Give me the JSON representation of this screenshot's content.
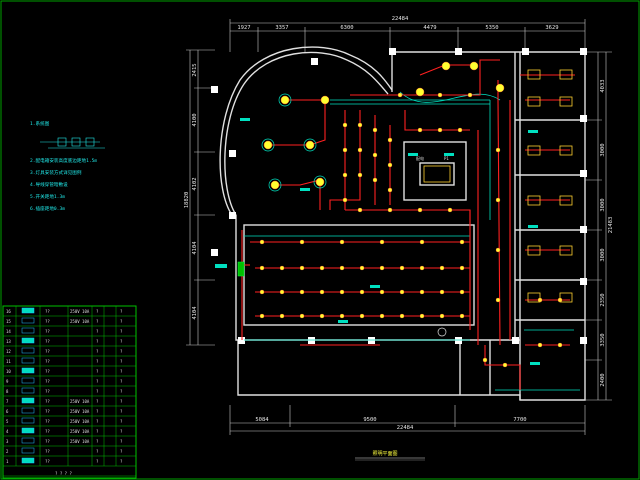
{
  "drawing": {
    "colors": {
      "background": "#000000",
      "wall": "#e8e8e8",
      "dimension": "#d0d0d0",
      "wiring": "#ff2020",
      "fixture": "#ffff30",
      "annotation": "#20e8e8",
      "green_frame": "#00b000",
      "cyan_device": "#00e0c0"
    },
    "top_dimensions": [
      "1927",
      "3357",
      "6300",
      "4479",
      "5350",
      "3629"
    ],
    "top_total": "22484",
    "bottom_dimensions": [
      "5084",
      "9500",
      "7700"
    ],
    "bottom_total": "22484",
    "left_dimensions": [
      "2415",
      "4100",
      "4102",
      "4104",
      "4104"
    ],
    "left_total": "18820",
    "right_dimensions": [
      "4033",
      "3000",
      "3000",
      "3000",
      "2350",
      "3350",
      "2400"
    ],
    "right_total": "21483",
    "title": "照明平面图",
    "notes": [
      "1.系统图",
      "2.配电箱安装高度底边距地1.5m",
      "3.灯具安装方式详见图例",
      "4.导线穿管暗敷设",
      "5.开关距地1.3m",
      "6.插座距地0.3m"
    ],
    "room_labels": [
      "配电",
      "P1"
    ]
  },
  "legend": {
    "rows": [
      {
        "num": "16",
        "text": "??",
        "spec": "250V 10A",
        "qty": "?",
        "note": "?"
      },
      {
        "num": "15",
        "text": "??",
        "spec": "250V 10A",
        "qty": "?",
        "note": "?"
      },
      {
        "num": "14",
        "text": "??",
        "spec": "",
        "qty": "?",
        "note": "?"
      },
      {
        "num": "13",
        "text": "??",
        "spec": "",
        "qty": "?",
        "note": "?"
      },
      {
        "num": "12",
        "text": "??",
        "spec": "",
        "qty": "?",
        "note": "?"
      },
      {
        "num": "11",
        "text": "??",
        "spec": "",
        "qty": "?",
        "note": "?"
      },
      {
        "num": "10",
        "text": "??",
        "spec": "",
        "qty": "?",
        "note": "?"
      },
      {
        "num": "9",
        "text": "??",
        "spec": "",
        "qty": "?",
        "note": "?"
      },
      {
        "num": "8",
        "text": "??",
        "spec": "",
        "qty": "?",
        "note": "?"
      },
      {
        "num": "7",
        "text": "??",
        "spec": "250V 10A",
        "qty": "?",
        "note": "?"
      },
      {
        "num": "6",
        "text": "??",
        "spec": "250V 10A",
        "qty": "?",
        "note": "?"
      },
      {
        "num": "5",
        "text": "??",
        "spec": "250V 10A",
        "qty": "?",
        "note": "?"
      },
      {
        "num": "4",
        "text": "??",
        "spec": "250V 10A",
        "qty": "?",
        "note": "?"
      },
      {
        "num": "3",
        "text": "??",
        "spec": "250V 10A",
        "qty": "?",
        "note": "?"
      },
      {
        "num": "2",
        "text": "??",
        "spec": "",
        "qty": "?",
        "note": "?"
      },
      {
        "num": "1",
        "text": "??",
        "spec": "",
        "qty": "?",
        "note": "?"
      }
    ],
    "footer": "? ? ? ?"
  }
}
